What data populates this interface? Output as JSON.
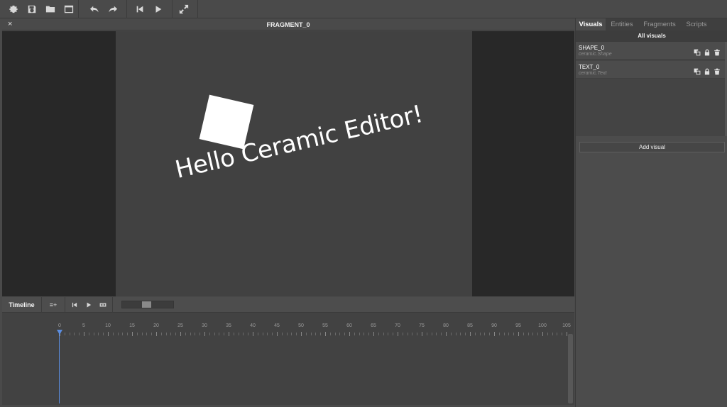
{
  "toolbar": {
    "icons": [
      "gear-icon",
      "save-icon",
      "folder-open-icon",
      "window-icon",
      "undo-icon",
      "redo-icon",
      "skip-back-icon",
      "play-icon",
      "fullscreen-icon"
    ]
  },
  "fragment": {
    "close_label": "×",
    "title": "FRAGMENT_0"
  },
  "canvas": {
    "text_content": "Hello Ceramic Editor!",
    "shape_color": "#ffffff",
    "stage_color": "#414141"
  },
  "timeline": {
    "title": "Timeline",
    "add_track_label": "≡+",
    "ruler": [
      "0",
      "5",
      "10",
      "15",
      "20",
      "25",
      "30",
      "35",
      "40",
      "45",
      "50",
      "55",
      "60",
      "65",
      "70",
      "75",
      "80",
      "85",
      "90",
      "95",
      "100",
      "105"
    ],
    "playhead_color": "#5b8de0",
    "zoom_level": 0.47
  },
  "right_panel": {
    "tabs": [
      {
        "label": "Visuals",
        "active": true
      },
      {
        "label": "Entities",
        "active": false
      },
      {
        "label": "Fragments",
        "active": false
      },
      {
        "label": "Scripts",
        "active": false
      }
    ],
    "subtitle": "All visuals",
    "items": [
      {
        "name": "SHAPE_0",
        "type": "ceramic.Shape"
      },
      {
        "name": "TEXT_0",
        "type": "ceramic.Text"
      }
    ],
    "add_button": "Add visual"
  }
}
